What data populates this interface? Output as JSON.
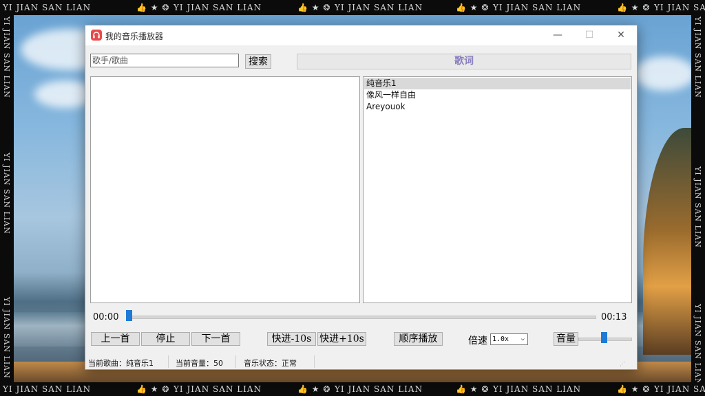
{
  "watermark": {
    "text": "YI JIAN SAN LIAN",
    "icons": [
      "thumbs-up-icon",
      "star-icon",
      "coin-icon"
    ]
  },
  "window": {
    "title": "我的音乐播放器",
    "controls": {
      "minimize": "—",
      "maximize": "☐",
      "close": "✕"
    }
  },
  "search": {
    "placeholder": "歌手/歌曲",
    "button_label": "搜索"
  },
  "lyrics_button_label": "歌词",
  "playlist": [
    {
      "title": "纯音乐1",
      "selected": true
    },
    {
      "title": "像风一样自由",
      "selected": false
    },
    {
      "title": "Areyouok",
      "selected": false
    }
  ],
  "progress": {
    "current_time": "00:00",
    "total_time": "00:13",
    "fraction": 0.0
  },
  "controls": {
    "prev": "上一首",
    "stop": "停止",
    "next": "下一首",
    "rewind": "快进-10s",
    "forward": "快进+10s",
    "play_mode": "顺序播放",
    "speed_label": "倍速",
    "speed_value": "1.0x",
    "volume_label": "音量",
    "volume_level": 0.5
  },
  "status": {
    "current_song": "当前歌曲：纯音乐1",
    "current_volume": "当前音量：50",
    "music_state": "音乐状态：正常"
  },
  "colors": {
    "accent": "#1e7ad6",
    "lyrics_text": "#8a7fbf",
    "app_icon": "#e84a4a",
    "selected_row": "#d9d9d9"
  }
}
